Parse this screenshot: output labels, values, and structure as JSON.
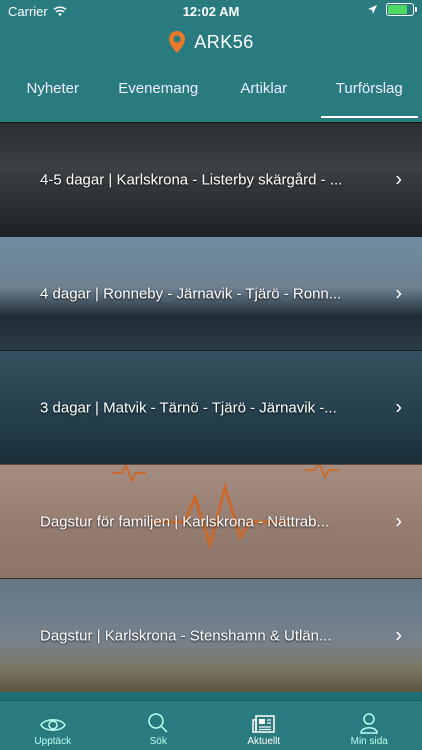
{
  "status_bar": {
    "carrier": "Carrier",
    "time": "12:02 AM"
  },
  "header": {
    "title": "ARK56"
  },
  "tabs": [
    {
      "label": "Nyheter"
    },
    {
      "label": "Evenemang"
    },
    {
      "label": "Artiklar"
    },
    {
      "label": "Turförslag"
    }
  ],
  "cards": [
    {
      "title": "4-5 dagar | Karlskrona - Listerby skärgård - ..."
    },
    {
      "title": "4 dagar | Ronneby - Järnavik - Tjärö - Ronn..."
    },
    {
      "title": "3 dagar | Matvik - Tärnö - Tjärö - Järnavik -..."
    },
    {
      "title": "Dagstur för familjen | Karlskrona - Nättrab..."
    },
    {
      "title": "Dagstur | Karlskrona - Stenshamn & Utlän..."
    }
  ],
  "tabbar": [
    {
      "label": "Upptäck"
    },
    {
      "label": "Sök"
    },
    {
      "label": "Aktuellt"
    },
    {
      "label": "Min sida"
    }
  ],
  "colors": {
    "primary": "#2a7b7f",
    "accent": "#e8782a"
  }
}
